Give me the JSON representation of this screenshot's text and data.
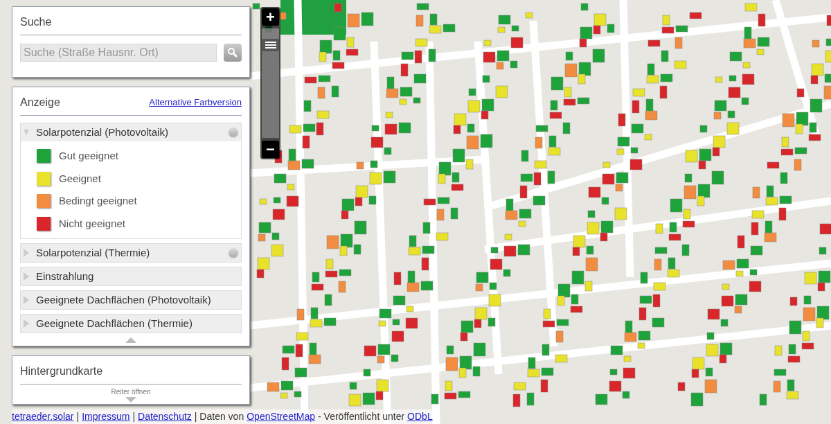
{
  "search": {
    "title": "Suche",
    "placeholder": "Suche (Straße Hausnr. Ort)"
  },
  "display": {
    "title": "Anzeige",
    "link": "Alternative Farbversion",
    "sections": [
      {
        "label": "Solarpotenzial (Photovoltaik)",
        "expanded": true,
        "info": true,
        "legend": [
          {
            "label": "Gut geeignet",
            "color": "#1ea33a"
          },
          {
            "label": "Geeignet",
            "color": "#e8e22a"
          },
          {
            "label": "Bedingt geeignet",
            "color": "#f28c40"
          },
          {
            "label": "Nicht geeignet",
            "color": "#d8262a"
          }
        ]
      },
      {
        "label": "Solarpotenzial (Thermie)",
        "expanded": false,
        "info": true
      },
      {
        "label": "Einstrahlung",
        "expanded": false,
        "info": false
      },
      {
        "label": "Geeignete Dachflächen (Photovoltaik)",
        "expanded": false,
        "info": false
      },
      {
        "label": "Geeignete Dachflächen (Thermie)",
        "expanded": false,
        "info": false
      }
    ]
  },
  "background_map": {
    "title": "Hintergrundkarte",
    "toggle": "Reiter öffnen"
  },
  "zoom": {
    "in": "+",
    "out": "−",
    "level": 0.85
  },
  "footer": [
    {
      "kind": "link",
      "text": "tetraeder.solar"
    },
    {
      "kind": "text",
      "text": "|"
    },
    {
      "kind": "link",
      "text": "Impressum"
    },
    {
      "kind": "text",
      "text": "|"
    },
    {
      "kind": "link",
      "text": "Datenschutz"
    },
    {
      "kind": "text",
      "text": "| Daten von"
    },
    {
      "kind": "link",
      "text": "OpenStreetMap"
    },
    {
      "kind": "text",
      "text": "- Veröffentlicht unter"
    },
    {
      "kind": "link",
      "text": "ODbL"
    }
  ]
}
